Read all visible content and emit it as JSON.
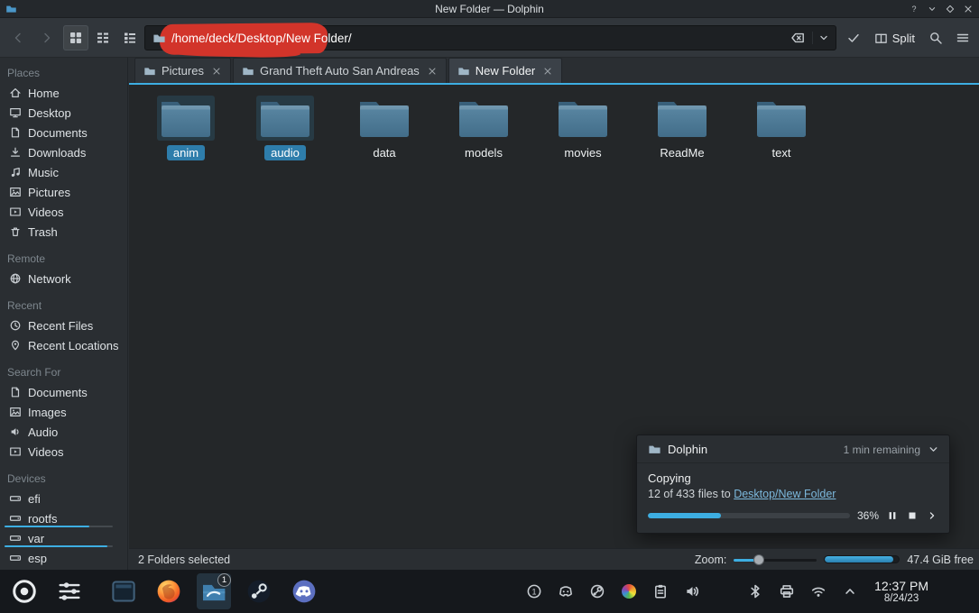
{
  "colors": {
    "accent": "#3daee2",
    "selection": "#2e7dab",
    "link": "#7cb8dc",
    "annotation_red": "#d2342a"
  },
  "titlebar": {
    "title": "New Folder — Dolphin"
  },
  "toolbar": {
    "path": "/home/deck/Desktop/New Folder/",
    "split_label": "Split"
  },
  "tabs": [
    {
      "label": "Pictures",
      "active": false
    },
    {
      "label": "Grand Theft Auto San Andreas",
      "active": false
    },
    {
      "label": "New Folder",
      "active": true
    }
  ],
  "sidebar": {
    "sections": [
      {
        "label": "Places",
        "items": [
          {
            "label": "Home",
            "icon": "home"
          },
          {
            "label": "Desktop",
            "icon": "desktop"
          },
          {
            "label": "Documents",
            "icon": "document"
          },
          {
            "label": "Downloads",
            "icon": "download"
          },
          {
            "label": "Music",
            "icon": "music"
          },
          {
            "label": "Pictures",
            "icon": "image"
          },
          {
            "label": "Videos",
            "icon": "video"
          },
          {
            "label": "Trash",
            "icon": "trash"
          }
        ]
      },
      {
        "label": "Remote",
        "items": [
          {
            "label": "Network",
            "icon": "network"
          }
        ]
      },
      {
        "label": "Recent",
        "items": [
          {
            "label": "Recent Files",
            "icon": "recent-files"
          },
          {
            "label": "Recent Locations",
            "icon": "recent-locations"
          }
        ]
      },
      {
        "label": "Search For",
        "items": [
          {
            "label": "Documents",
            "icon": "document"
          },
          {
            "label": "Images",
            "icon": "image"
          },
          {
            "label": "Audio",
            "icon": "audio"
          },
          {
            "label": "Videos",
            "icon": "video"
          }
        ]
      },
      {
        "label": "Devices",
        "items": [
          {
            "label": "efi",
            "icon": "drive"
          },
          {
            "label": "rootfs",
            "icon": "drive",
            "capacity": 78
          },
          {
            "label": "var",
            "icon": "drive",
            "capacity": 95
          },
          {
            "label": "esp",
            "icon": "drive"
          }
        ]
      }
    ]
  },
  "folders": [
    {
      "name": "anim",
      "selected": true
    },
    {
      "name": "audio",
      "selected": true
    },
    {
      "name": "data",
      "selected": false
    },
    {
      "name": "models",
      "selected": false
    },
    {
      "name": "movies",
      "selected": false
    },
    {
      "name": "ReadMe",
      "selected": false
    },
    {
      "name": "text",
      "selected": false
    }
  ],
  "notification": {
    "app_name": "Dolphin",
    "remaining": "1 min remaining",
    "operation": "Copying",
    "detail_prefix": "12 of 433 files to ",
    "detail_link": "Desktop/New Folder",
    "percent": 36,
    "percent_label": "36%"
  },
  "statusbar": {
    "selection_text": "2 Folders selected",
    "zoom_label": "Zoom:",
    "zoom_value": 30,
    "disk_fill": 92,
    "free_space": "47.4 GiB free"
  },
  "taskbar": {
    "tray_badge": "1",
    "clock_time": "12:37 PM",
    "clock_date": "8/24/23",
    "apps": [
      {
        "name": "app-launcher",
        "icon": "steamdeck"
      },
      {
        "name": "task-manager",
        "icon": "sliders"
      },
      {
        "name": "desktop-window",
        "icon": "window"
      },
      {
        "name": "firefox",
        "icon": "firefox"
      },
      {
        "name": "dolphin",
        "icon": "dolphin",
        "active": true,
        "badge": "1"
      },
      {
        "name": "steam",
        "icon": "steam"
      },
      {
        "name": "discord",
        "icon": "discord"
      }
    ],
    "tray": [
      {
        "name": "notifications",
        "icon": "circle-1"
      },
      {
        "name": "discord-tray",
        "icon": "discord-mono"
      },
      {
        "name": "steam-tray",
        "icon": "steam-mono"
      },
      {
        "name": "color-app",
        "icon": "color-wheel"
      },
      {
        "name": "clipboard",
        "icon": "clipboard"
      },
      {
        "name": "volume",
        "icon": "volume"
      },
      {
        "name": "display",
        "icon": "display"
      },
      {
        "name": "bluetooth",
        "icon": "bluetooth"
      },
      {
        "name": "printer",
        "icon": "printer"
      },
      {
        "name": "network-wifi",
        "icon": "wifi"
      },
      {
        "name": "expand-tray",
        "icon": "chevron-up"
      }
    ]
  }
}
